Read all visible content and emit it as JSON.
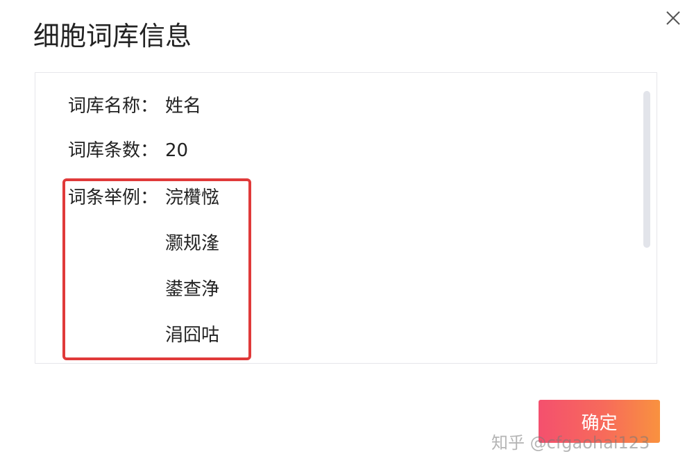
{
  "dialog": {
    "title": "细胞词库信息",
    "confirm_label": "确定"
  },
  "info": {
    "name_label": "词库名称：",
    "name_value": "姓名",
    "count_label": "词库条数：",
    "count_value": "20",
    "examples_label": "词条举例：",
    "examples": [
      "浣欑惤",
      "灏规湰",
      "鍙查浄",
      "涓囧咕"
    ]
  },
  "watermark": "知乎 @cfgaohai123",
  "colors": {
    "highlight_border": "#e03a3a",
    "button_gradient_start": "#f4506e",
    "button_gradient_end": "#f9923f",
    "panel_border": "#e6e6ea",
    "scrollbar": "#e2e4ea"
  },
  "icons": {
    "close": "close-icon"
  }
}
